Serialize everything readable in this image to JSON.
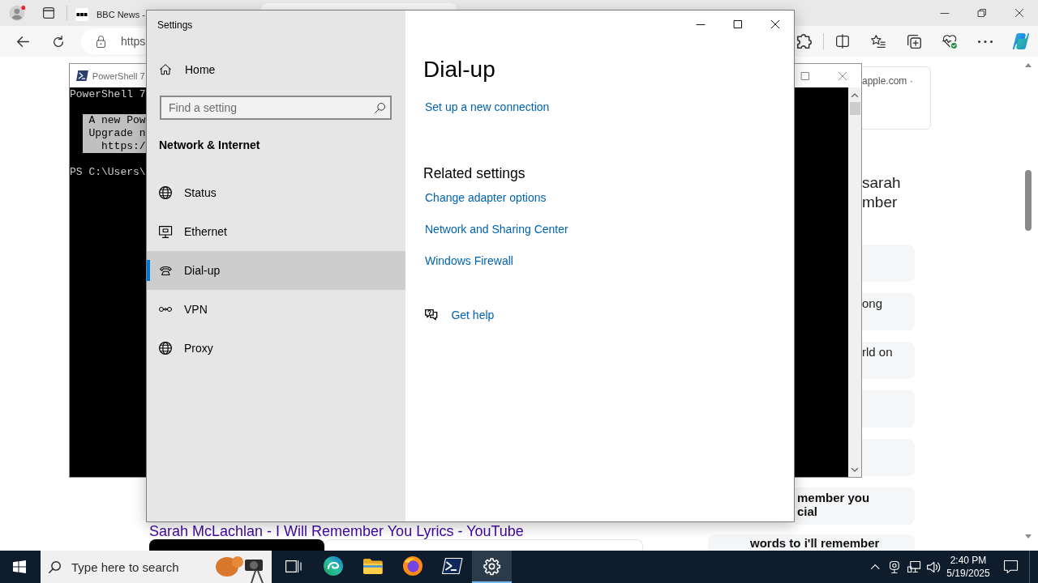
{
  "browser": {
    "tabs": [
      {
        "label": "BBC News -",
        "selected": false
      },
      {
        "selected": true
      }
    ],
    "address": {
      "value": "https"
    }
  },
  "web_page": {
    "source_card": "apple.com ·",
    "headline": [
      "sarah",
      "mber"
    ],
    "cards": [
      {
        "kind": "plain"
      },
      {
        "kind": "plain",
        "lines": [
          "ong"
        ]
      },
      {
        "kind": "plain",
        "lines": [
          "rld on"
        ]
      },
      {
        "kind": "plain"
      },
      {
        "kind": "plain"
      },
      {
        "kind": "bold",
        "lines": [
          "member you",
          "cial"
        ]
      }
    ],
    "result_title": "Sarah McLachlan - I Will Remember You Lyrics - YouTube",
    "snippet": "words to i'll remember"
  },
  "powershell": {
    "title": "PowerShell 7",
    "lines": [
      "PowerShell 7"
    ],
    "notice": [
      "A new Pow",
      "Upgrade n",
      "https:/"
    ],
    "prompt": "PS C:\\Users\\"
  },
  "settings": {
    "title": "Settings",
    "home": "Home",
    "search": {
      "placeholder": "Find a setting"
    },
    "section": "Network & Internet",
    "nav": [
      {
        "kind": "status",
        "label": "Status",
        "selected": false
      },
      {
        "kind": "ethernet",
        "label": "Ethernet",
        "selected": false
      },
      {
        "kind": "dialup",
        "label": "Dial-up",
        "selected": true
      },
      {
        "kind": "vpn",
        "label": "VPN",
        "selected": false
      },
      {
        "kind": "proxy",
        "label": "Proxy",
        "selected": false
      }
    ],
    "page_title": "Dial-up",
    "links": [
      "Set up a new connection"
    ],
    "related": {
      "heading": "Related settings",
      "links": [
        "Change adapter options",
        "Network and Sharing Center",
        "Windows Firewall"
      ]
    },
    "help": "Get help"
  },
  "taskbar": {
    "search": {
      "placeholder": "Type here to search"
    },
    "apps": [
      {
        "kind": "task-view",
        "selected": false
      },
      {
        "kind": "edge",
        "selected": false
      },
      {
        "kind": "explorer",
        "selected": false
      },
      {
        "kind": "firefox",
        "selected": false
      },
      {
        "kind": "powershell",
        "selected": false
      },
      {
        "kind": "settings",
        "selected": true
      }
    ],
    "clock": {
      "time": "2:40 PM",
      "date": "5/19/2025"
    }
  }
}
